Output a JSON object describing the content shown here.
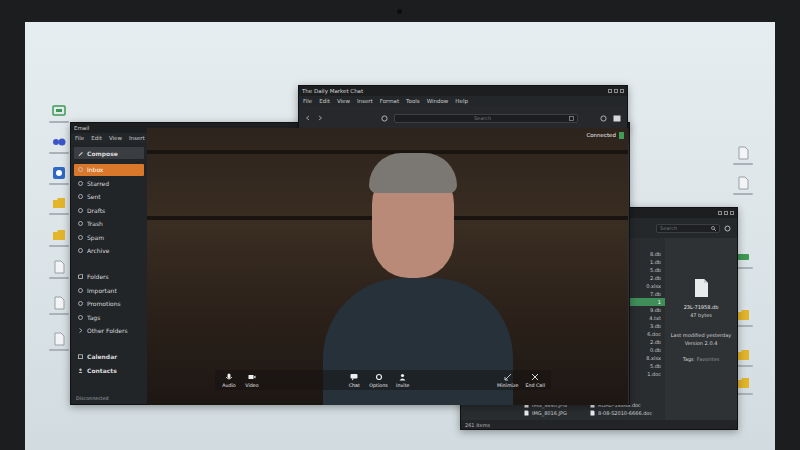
{
  "email": {
    "title": "Email",
    "menu": [
      "File",
      "Edit",
      "View",
      "Insert"
    ],
    "compose": "Compose",
    "mailboxes": [
      {
        "label": "Inbox",
        "selected": true
      },
      {
        "label": "Starred",
        "selected": false
      },
      {
        "label": "Sent",
        "selected": false
      },
      {
        "label": "Drafts",
        "selected": false
      },
      {
        "label": "Trash",
        "selected": false
      },
      {
        "label": "Spam",
        "selected": false
      },
      {
        "label": "Archive",
        "selected": false
      }
    ],
    "folders": {
      "heading": "Folders",
      "items": [
        "Important",
        "Promotions",
        "Tags"
      ],
      "more": "Other Folders"
    },
    "apps": [
      "Calendar",
      "Contacts"
    ],
    "status": "Disconnected"
  },
  "chat": {
    "title": "The Daily Market Chat",
    "menu": [
      "File",
      "Edit",
      "View",
      "Insert",
      "Format",
      "Tools",
      "Window",
      "Help"
    ],
    "search": {
      "placeholder": "Search"
    },
    "call_status": "Connected",
    "controls_left": [
      "Audio",
      "Video"
    ],
    "controls_center": [
      "Chat",
      "Options",
      "Invite"
    ],
    "controls_right": [
      "Minimize",
      "End Call"
    ]
  },
  "files": {
    "search": {
      "placeholder": "Search"
    },
    "list": [
      {
        "name": "8.db",
        "selected": false
      },
      {
        "name": "1.db",
        "selected": false
      },
      {
        "name": "5.db",
        "selected": false
      },
      {
        "name": "2.db",
        "selected": false
      },
      {
        "name": "0.xlsx",
        "selected": false
      },
      {
        "name": "7.db",
        "selected": false
      },
      {
        "name": "1",
        "selected": true
      },
      {
        "name": "9.db",
        "selected": false
      },
      {
        "name": "4.txt",
        "selected": false
      },
      {
        "name": "3.db",
        "selected": false
      },
      {
        "name": "6.doc",
        "selected": false
      },
      {
        "name": "2.db",
        "selected": false
      },
      {
        "name": "0.db",
        "selected": false
      },
      {
        "name": "8.xlsx",
        "selected": false
      },
      {
        "name": "5.db",
        "selected": false
      },
      {
        "name": "1.doc",
        "selected": false
      }
    ],
    "grid": [
      "IMG_9840.JPG",
      "ROAD-14869.doc",
      "IMG_8016.JPG",
      "8-08-S2010-6666.doc"
    ],
    "details": {
      "name": "23L-71958.db",
      "size": "47 bytes",
      "modified": "Last modified yesterday",
      "version": "Version 2.0.4",
      "tags_label": "Tags",
      "tags_value": "Favorites"
    },
    "status": "261 Items"
  }
}
